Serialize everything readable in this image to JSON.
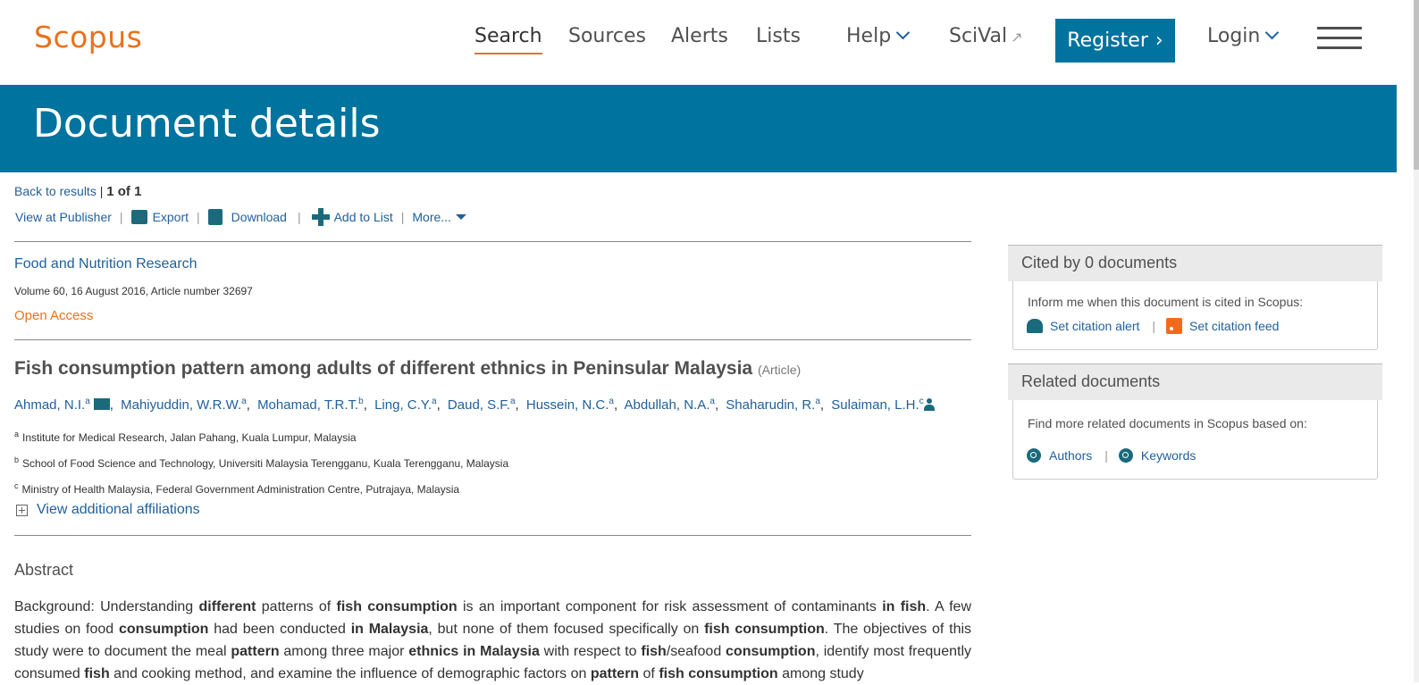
{
  "header": {
    "logo": "Scopus",
    "nav": [
      {
        "label": "Search"
      },
      {
        "label": "Sources"
      },
      {
        "label": "Alerts"
      },
      {
        "label": "Lists"
      },
      {
        "label": "Help"
      },
      {
        "label": "SciVal"
      }
    ],
    "register_label": "Register",
    "login_label": "Login"
  },
  "banner": {
    "title": "Document details"
  },
  "toolbar": {
    "back_label": "Back to results",
    "count": "1 of 1",
    "view_publisher": "View at Publisher",
    "export": "Export",
    "download": "Download",
    "add_to_list": "Add to List",
    "more": "More..."
  },
  "document": {
    "journal": "Food and Nutrition Research",
    "volume": "Volume 60, 16 August 2016, Article number 32697",
    "open_access": "Open Access",
    "title": "Fish consumption pattern among adults of different ethnics in Peninsular Malaysia",
    "type": "(Article)",
    "authors": [
      {
        "name": "Ahmad, N.I.",
        "sup": "a"
      },
      {
        "name": "Mahiyuddin, W.R.W.",
        "sup": "a"
      },
      {
        "name": "Mohamad, T.R.T.",
        "sup": "b"
      },
      {
        "name": "Ling, C.Y.",
        "sup": "a"
      },
      {
        "name": "Daud, S.F.",
        "sup": "a"
      },
      {
        "name": "Hussein, N.C.",
        "sup": "a"
      },
      {
        "name": "Abdullah, N.A.",
        "sup": "a"
      },
      {
        "name": "Shaharudin, R.",
        "sup": "a"
      },
      {
        "name": "Sulaiman, L.H.",
        "sup": "c"
      }
    ],
    "affiliations": [
      {
        "sup": "a",
        "text": "Institute for Medical Research, Jalan Pahang, Kuala Lumpur, Malaysia"
      },
      {
        "sup": "b",
        "text": "School of Food Science and Technology, Universiti Malaysia Terengganu, Kuala Terengganu, Malaysia"
      },
      {
        "sup": "c",
        "text": "Ministry of Health Malaysia, Federal Government Administration Centre, Putrajaya, Malaysia"
      }
    ],
    "view_affiliations": "View additional affiliations",
    "abstract_heading": "Abstract",
    "abstract_segments": [
      {
        "t": "Background: Understanding ",
        "b": false
      },
      {
        "t": "different",
        "b": true
      },
      {
        "t": " patterns of ",
        "b": false
      },
      {
        "t": "fish consumption",
        "b": true
      },
      {
        "t": " is an important component for risk assessment of contaminants ",
        "b": false
      },
      {
        "t": "in fish",
        "b": true
      },
      {
        "t": ". A few studies on food ",
        "b": false
      },
      {
        "t": "consumption",
        "b": true
      },
      {
        "t": " had been conducted ",
        "b": false
      },
      {
        "t": "in Malaysia",
        "b": true
      },
      {
        "t": ", but none of them focused specifically on ",
        "b": false
      },
      {
        "t": "fish consumption",
        "b": true
      },
      {
        "t": ". The objectives of this study were to document the meal ",
        "b": false
      },
      {
        "t": "pattern",
        "b": true
      },
      {
        "t": " among three major ",
        "b": false
      },
      {
        "t": "ethnics in Malaysia",
        "b": true
      },
      {
        "t": " with respect to ",
        "b": false
      },
      {
        "t": "fish",
        "b": true
      },
      {
        "t": "/seafood ",
        "b": false
      },
      {
        "t": "consumption",
        "b": true
      },
      {
        "t": ", identify most frequently consumed ",
        "b": false
      },
      {
        "t": "fish",
        "b": true
      },
      {
        "t": " and cooking method, and examine the influence of demographic factors on ",
        "b": false
      },
      {
        "t": "pattern",
        "b": true
      },
      {
        "t": " of ",
        "b": false
      },
      {
        "t": "fish consumption",
        "b": true
      },
      {
        "t": " among study",
        "b": false
      }
    ]
  },
  "sidebar": {
    "cited_heading": "Cited by 0 documents",
    "cited_text": "Inform me when this document is cited in Scopus:",
    "set_alert": "Set citation alert",
    "set_feed": "Set citation feed",
    "related_heading": "Related documents",
    "related_text": "Find more related documents in Scopus based on:",
    "authors_link": "Authors",
    "keywords_link": "Keywords"
  }
}
